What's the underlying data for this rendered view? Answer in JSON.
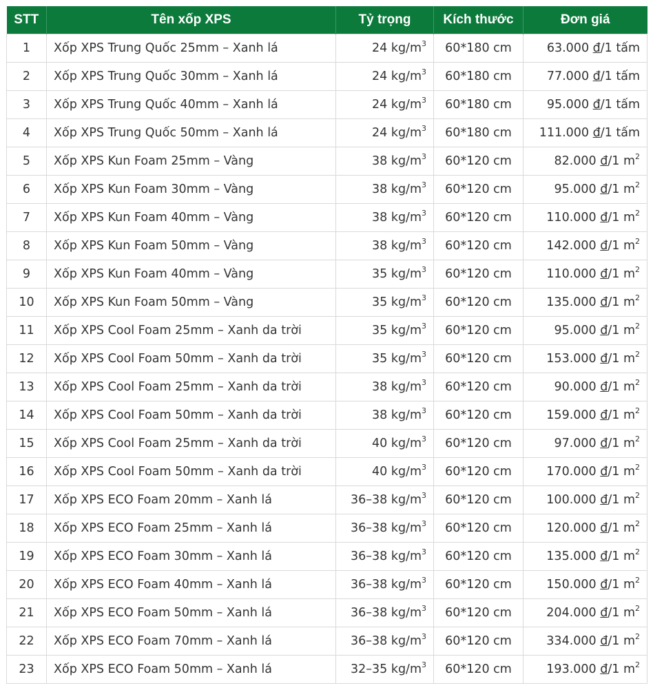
{
  "header": {
    "stt": "STT",
    "name": "Tên xốp XPS",
    "density": "Tỷ trọng",
    "size": "Kích thước",
    "price": "Đơn giá"
  },
  "unit_density": "kg/m",
  "unit_sup": "3",
  "currency": "đ",
  "rows": [
    {
      "stt": "1",
      "name": "Xốp XPS Trung Quốc 25mm – Xanh lá",
      "density": "24",
      "size": "60*180 cm",
      "price": "63.000",
      "per": "/1 tấm",
      "sup": ""
    },
    {
      "stt": "2",
      "name": "Xốp XPS Trung Quốc 30mm – Xanh lá",
      "density": "24",
      "size": "60*180 cm",
      "price": "77.000",
      "per": "/1 tấm",
      "sup": ""
    },
    {
      "stt": "3",
      "name": "Xốp XPS Trung Quốc 40mm – Xanh lá",
      "density": "24",
      "size": "60*180 cm",
      "price": "95.000",
      "per": "/1 tấm",
      "sup": ""
    },
    {
      "stt": "4",
      "name": "Xốp XPS Trung Quốc 50mm – Xanh lá",
      "density": "24",
      "size": "60*180 cm",
      "price": "111.000",
      "per": "/1 tấm",
      "sup": ""
    },
    {
      "stt": "5",
      "name": "Xốp XPS Kun Foam 25mm – Vàng",
      "density": "38",
      "size": "60*120 cm",
      "price": "82.000",
      "per": "/1 m",
      "sup": "2"
    },
    {
      "stt": "6",
      "name": "Xốp XPS Kun Foam 30mm – Vàng",
      "density": "38",
      "size": "60*120 cm",
      "price": "95.000",
      "per": "/1 m",
      "sup": "2"
    },
    {
      "stt": "7",
      "name": "Xốp XPS Kun Foam 40mm – Vàng",
      "density": "38",
      "size": "60*120 cm",
      "price": "110.000",
      "per": "/1 m",
      "sup": "2"
    },
    {
      "stt": "8",
      "name": "Xốp XPS Kun Foam 50mm – Vàng",
      "density": "38",
      "size": "60*120 cm",
      "price": "142.000",
      "per": "/1 m",
      "sup": "2"
    },
    {
      "stt": "9",
      "name": "Xốp XPS Kun Foam 40mm – Vàng",
      "density": "35",
      "size": "60*120 cm",
      "price": "110.000",
      "per": "/1 m",
      "sup": "2"
    },
    {
      "stt": "10",
      "name": "Xốp XPS Kun Foam 50mm – Vàng",
      "density": "35",
      "size": "60*120 cm",
      "price": "135.000",
      "per": "/1 m",
      "sup": "2"
    },
    {
      "stt": "11",
      "name": "Xốp XPS Cool Foam 25mm – Xanh da trời",
      "density": "35",
      "size": "60*120 cm",
      "price": "95.000",
      "per": "/1 m",
      "sup": "2"
    },
    {
      "stt": "12",
      "name": "Xốp XPS Cool Foam 50mm – Xanh da trời",
      "density": "35",
      "size": "60*120 cm",
      "price": "153.000",
      "per": "/1 m",
      "sup": "2"
    },
    {
      "stt": "13",
      "name": "Xốp XPS Cool Foam 25mm – Xanh da trời",
      "density": "38",
      "size": "60*120 cm",
      "price": "90.000",
      "per": "/1 m",
      "sup": "2"
    },
    {
      "stt": "14",
      "name": "Xốp XPS Cool Foam 50mm – Xanh da trời",
      "density": "38",
      "size": "60*120 cm",
      "price": "159.000",
      "per": "/1 m",
      "sup": "2"
    },
    {
      "stt": "15",
      "name": "Xốp XPS Cool Foam 25mm – Xanh da trời",
      "density": "40",
      "size": "60*120 cm",
      "price": "97.000",
      "per": "/1 m",
      "sup": "2"
    },
    {
      "stt": "16",
      "name": "Xốp XPS Cool Foam 50mm – Xanh da trời",
      "density": "40",
      "size": "60*120 cm",
      "price": "170.000",
      "per": "/1 m",
      "sup": "2"
    },
    {
      "stt": "17",
      "name": "Xốp XPS ECO Foam 20mm – Xanh lá",
      "density": "36–38",
      "size": "60*120 cm",
      "price": "100.000",
      "per": "/1 m",
      "sup": "2"
    },
    {
      "stt": "18",
      "name": "Xốp XPS ECO Foam 25mm – Xanh lá",
      "density": "36–38",
      "size": "60*120 cm",
      "price": "120.000",
      "per": "/1 m",
      "sup": "2"
    },
    {
      "stt": "19",
      "name": "Xốp XPS ECO Foam 30mm – Xanh lá",
      "density": "36–38",
      "size": "60*120 cm",
      "price": "135.000",
      "per": "/1 m",
      "sup": "2"
    },
    {
      "stt": "20",
      "name": "Xốp XPS ECO Foam 40mm – Xanh lá",
      "density": "36–38",
      "size": "60*120 cm",
      "price": "150.000",
      "per": "/1 m",
      "sup": "2"
    },
    {
      "stt": "21",
      "name": "Xốp XPS ECO Foam 50mm – Xanh lá",
      "density": "36–38",
      "size": "60*120 cm",
      "price": "204.000",
      "per": "/1 m",
      "sup": "2"
    },
    {
      "stt": "22",
      "name": "Xốp XPS ECO Foam 70mm – Xanh lá",
      "density": "36–38",
      "size": "60*120 cm",
      "price": "334.000",
      "per": "/1 m",
      "sup": "2"
    },
    {
      "stt": "23",
      "name": "Xốp XPS ECO Foam 50mm – Xanh lá",
      "density": "32–35",
      "size": "60*120 cm",
      "price": "193.000",
      "per": "/1 m",
      "sup": "2"
    }
  ],
  "colors": {
    "header_bg": "#0b7a3b",
    "header_text": "#ffffff",
    "border": "#d9d9d9",
    "text": "#333333"
  }
}
